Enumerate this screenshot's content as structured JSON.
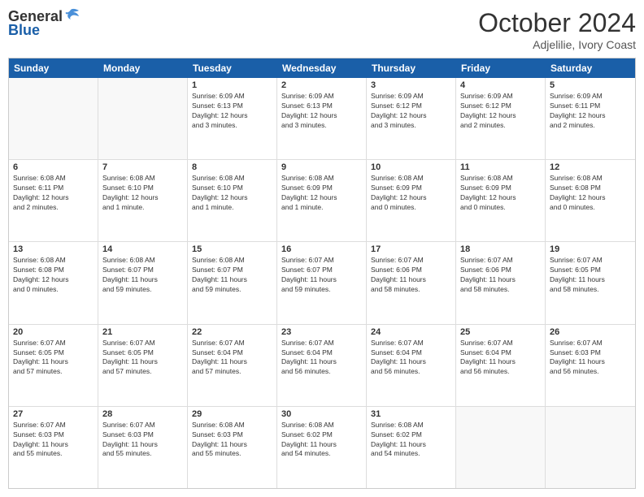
{
  "logo": {
    "general": "General",
    "blue": "Blue"
  },
  "title": "October 2024",
  "subtitle": "Adjelilie, Ivory Coast",
  "header": {
    "days": [
      "Sunday",
      "Monday",
      "Tuesday",
      "Wednesday",
      "Thursday",
      "Friday",
      "Saturday"
    ]
  },
  "weeks": [
    [
      {
        "day": "",
        "lines": []
      },
      {
        "day": "",
        "lines": []
      },
      {
        "day": "1",
        "lines": [
          "Sunrise: 6:09 AM",
          "Sunset: 6:13 PM",
          "Daylight: 12 hours",
          "and 3 minutes."
        ]
      },
      {
        "day": "2",
        "lines": [
          "Sunrise: 6:09 AM",
          "Sunset: 6:13 PM",
          "Daylight: 12 hours",
          "and 3 minutes."
        ]
      },
      {
        "day": "3",
        "lines": [
          "Sunrise: 6:09 AM",
          "Sunset: 6:12 PM",
          "Daylight: 12 hours",
          "and 3 minutes."
        ]
      },
      {
        "day": "4",
        "lines": [
          "Sunrise: 6:09 AM",
          "Sunset: 6:12 PM",
          "Daylight: 12 hours",
          "and 2 minutes."
        ]
      },
      {
        "day": "5",
        "lines": [
          "Sunrise: 6:09 AM",
          "Sunset: 6:11 PM",
          "Daylight: 12 hours",
          "and 2 minutes."
        ]
      }
    ],
    [
      {
        "day": "6",
        "lines": [
          "Sunrise: 6:08 AM",
          "Sunset: 6:11 PM",
          "Daylight: 12 hours",
          "and 2 minutes."
        ]
      },
      {
        "day": "7",
        "lines": [
          "Sunrise: 6:08 AM",
          "Sunset: 6:10 PM",
          "Daylight: 12 hours",
          "and 1 minute."
        ]
      },
      {
        "day": "8",
        "lines": [
          "Sunrise: 6:08 AM",
          "Sunset: 6:10 PM",
          "Daylight: 12 hours",
          "and 1 minute."
        ]
      },
      {
        "day": "9",
        "lines": [
          "Sunrise: 6:08 AM",
          "Sunset: 6:09 PM",
          "Daylight: 12 hours",
          "and 1 minute."
        ]
      },
      {
        "day": "10",
        "lines": [
          "Sunrise: 6:08 AM",
          "Sunset: 6:09 PM",
          "Daylight: 12 hours",
          "and 0 minutes."
        ]
      },
      {
        "day": "11",
        "lines": [
          "Sunrise: 6:08 AM",
          "Sunset: 6:09 PM",
          "Daylight: 12 hours",
          "and 0 minutes."
        ]
      },
      {
        "day": "12",
        "lines": [
          "Sunrise: 6:08 AM",
          "Sunset: 6:08 PM",
          "Daylight: 12 hours",
          "and 0 minutes."
        ]
      }
    ],
    [
      {
        "day": "13",
        "lines": [
          "Sunrise: 6:08 AM",
          "Sunset: 6:08 PM",
          "Daylight: 12 hours",
          "and 0 minutes."
        ]
      },
      {
        "day": "14",
        "lines": [
          "Sunrise: 6:08 AM",
          "Sunset: 6:07 PM",
          "Daylight: 11 hours",
          "and 59 minutes."
        ]
      },
      {
        "day": "15",
        "lines": [
          "Sunrise: 6:08 AM",
          "Sunset: 6:07 PM",
          "Daylight: 11 hours",
          "and 59 minutes."
        ]
      },
      {
        "day": "16",
        "lines": [
          "Sunrise: 6:07 AM",
          "Sunset: 6:07 PM",
          "Daylight: 11 hours",
          "and 59 minutes."
        ]
      },
      {
        "day": "17",
        "lines": [
          "Sunrise: 6:07 AM",
          "Sunset: 6:06 PM",
          "Daylight: 11 hours",
          "and 58 minutes."
        ]
      },
      {
        "day": "18",
        "lines": [
          "Sunrise: 6:07 AM",
          "Sunset: 6:06 PM",
          "Daylight: 11 hours",
          "and 58 minutes."
        ]
      },
      {
        "day": "19",
        "lines": [
          "Sunrise: 6:07 AM",
          "Sunset: 6:05 PM",
          "Daylight: 11 hours",
          "and 58 minutes."
        ]
      }
    ],
    [
      {
        "day": "20",
        "lines": [
          "Sunrise: 6:07 AM",
          "Sunset: 6:05 PM",
          "Daylight: 11 hours",
          "and 57 minutes."
        ]
      },
      {
        "day": "21",
        "lines": [
          "Sunrise: 6:07 AM",
          "Sunset: 6:05 PM",
          "Daylight: 11 hours",
          "and 57 minutes."
        ]
      },
      {
        "day": "22",
        "lines": [
          "Sunrise: 6:07 AM",
          "Sunset: 6:04 PM",
          "Daylight: 11 hours",
          "and 57 minutes."
        ]
      },
      {
        "day": "23",
        "lines": [
          "Sunrise: 6:07 AM",
          "Sunset: 6:04 PM",
          "Daylight: 11 hours",
          "and 56 minutes."
        ]
      },
      {
        "day": "24",
        "lines": [
          "Sunrise: 6:07 AM",
          "Sunset: 6:04 PM",
          "Daylight: 11 hours",
          "and 56 minutes."
        ]
      },
      {
        "day": "25",
        "lines": [
          "Sunrise: 6:07 AM",
          "Sunset: 6:04 PM",
          "Daylight: 11 hours",
          "and 56 minutes."
        ]
      },
      {
        "day": "26",
        "lines": [
          "Sunrise: 6:07 AM",
          "Sunset: 6:03 PM",
          "Daylight: 11 hours",
          "and 56 minutes."
        ]
      }
    ],
    [
      {
        "day": "27",
        "lines": [
          "Sunrise: 6:07 AM",
          "Sunset: 6:03 PM",
          "Daylight: 11 hours",
          "and 55 minutes."
        ]
      },
      {
        "day": "28",
        "lines": [
          "Sunrise: 6:07 AM",
          "Sunset: 6:03 PM",
          "Daylight: 11 hours",
          "and 55 minutes."
        ]
      },
      {
        "day": "29",
        "lines": [
          "Sunrise: 6:08 AM",
          "Sunset: 6:03 PM",
          "Daylight: 11 hours",
          "and 55 minutes."
        ]
      },
      {
        "day": "30",
        "lines": [
          "Sunrise: 6:08 AM",
          "Sunset: 6:02 PM",
          "Daylight: 11 hours",
          "and 54 minutes."
        ]
      },
      {
        "day": "31",
        "lines": [
          "Sunrise: 6:08 AM",
          "Sunset: 6:02 PM",
          "Daylight: 11 hours",
          "and 54 minutes."
        ]
      },
      {
        "day": "",
        "lines": []
      },
      {
        "day": "",
        "lines": []
      }
    ]
  ]
}
